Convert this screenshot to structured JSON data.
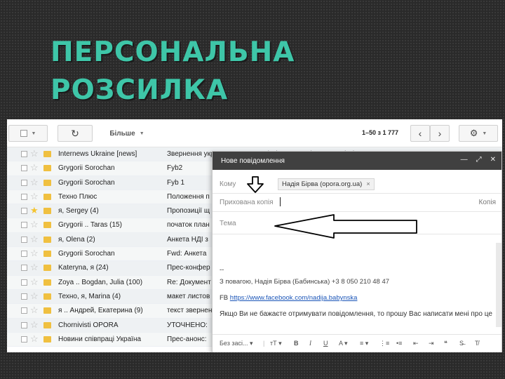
{
  "slide": {
    "title_line1": "ПЕРСОНАЛЬНА",
    "title_line2": "РОЗСИЛКА"
  },
  "toolbar": {
    "refresh_icon": "refresh-icon",
    "more_label": "Більше",
    "pagination": "1–50 з 1 777",
    "settings_icon": "gear-icon",
    "prev_label": "‹",
    "next_label": "›"
  },
  "inbox": {
    "rows": [
      {
        "sender": "Internews Ukraine [news]",
        "subject": "Звернення українських журналістів, експертів та активістів щодо створення пу",
        "starred": false
      },
      {
        "sender": "Grygorii Sorochan",
        "subject": "Fyb2",
        "starred": false
      },
      {
        "sender": "Grygorii Sorochan",
        "subject": "Fyb 1",
        "starred": false
      },
      {
        "sender": "Техно Плюс",
        "subject": "Положення п",
        "starred": false
      },
      {
        "sender": "я, Sergey (4)",
        "subject": "Пропозиції щ",
        "starred": true
      },
      {
        "sender": "Grygorii .. Taras (15)",
        "subject": "початок план",
        "starred": false
      },
      {
        "sender": "я, Olena (2)",
        "subject": "Анкета НДІ з",
        "starred": false
      },
      {
        "sender": "Grygorii Sorochan",
        "subject": "Fwd: Анкета",
        "starred": false
      },
      {
        "sender": "Kateryna, я (24)",
        "subject": "Прес-конфер",
        "starred": false
      },
      {
        "sender": "Zoya .. Bogdan, Julia (100)",
        "subject": "Re: Документ",
        "starred": false
      },
      {
        "sender": "Техно, я, Marina (4)",
        "subject": "макет листов",
        "starred": false
      },
      {
        "sender": "я .. Андрей, Екатерина (9)",
        "subject": "текст звернен",
        "starred": false
      },
      {
        "sender": "Chornivisti OPORA",
        "subject": "УТОЧНЕНО:",
        "starred": false
      },
      {
        "sender": "Новини співпраці Україна",
        "subject": "Прес-анонс:",
        "starred": false
      }
    ]
  },
  "compose": {
    "title": "Нове повідомлення",
    "to_label": "Кому",
    "recipient": "Надія Бірва (opora.org.ua)",
    "bcc_label": "Прихована копія",
    "cc_link": "Копія",
    "subject_placeholder": "Тема",
    "sig_dash": "--",
    "signature": "З повагою, Надія Бірва (Бабинська) +3 8 050 210 48 47",
    "fb_prefix": "FB",
    "fb_link": "https://www.facebook.com/nadija.babynska",
    "unsubscribe": "Якщо Ви не бажаєте отримувати повідомлення, то прошу Вас написати мені про це",
    "font_label": "Без засі...",
    "colors": {
      "header": "#404040",
      "link": "#1a55b8"
    }
  }
}
